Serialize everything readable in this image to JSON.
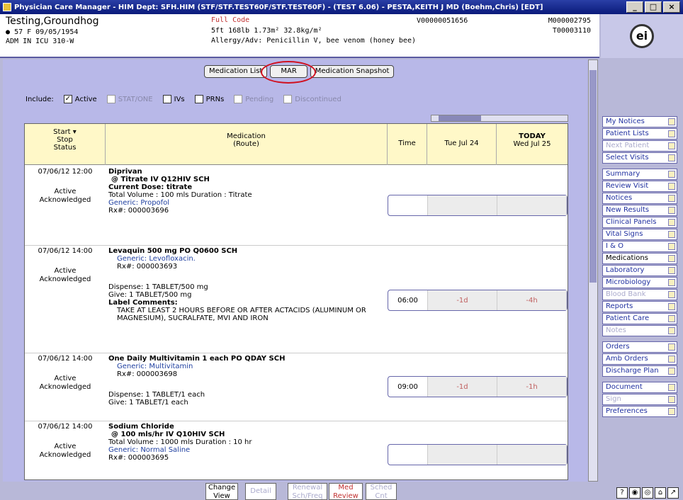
{
  "window": {
    "title": "Physician Care Manager - HIM Dept: SFH.HIM (STF/STF.TEST60F/STF.TEST60F) - (TEST 6.06) - PESTA,KEITH J MD (Boehm,Chris) [EDT]"
  },
  "patient": {
    "name": "Testing,Groundhog",
    "demo": "57 F 09/05/1954",
    "adm": "ADM IN ICU 310-W",
    "code": "Full Code",
    "vitals": "5ft 168lb 1.73m² 32.8kg/m²",
    "allergy": "Allergy/Adv: Penicillin V, bee venom (honey bee)",
    "visit": "V00000051656",
    "mrn": "M000002795",
    "unit": "T00003110"
  },
  "tabs": [
    "Medication List",
    "MAR",
    "Medication Snapshot"
  ],
  "include": {
    "label": "Include:",
    "options": [
      {
        "label": "Active",
        "checked": true,
        "disabled": false
      },
      {
        "label": "STAT/ONE",
        "checked": false,
        "disabled": true
      },
      {
        "label": "IVs",
        "checked": false,
        "disabled": false
      },
      {
        "label": "PRNs",
        "checked": false,
        "disabled": false
      },
      {
        "label": "Pending",
        "checked": false,
        "disabled": true
      },
      {
        "label": "Discontinued",
        "checked": false,
        "disabled": true
      }
    ]
  },
  "grid": {
    "col_start": "Start ▾",
    "col_stop": "Stop",
    "col_status": "Status",
    "col_med": "Medication",
    "col_route": "(Route)",
    "col_time": "Time",
    "col_d1": "Tue Jul 24",
    "col_today": "TODAY",
    "col_d2": "Wed Jul 25"
  },
  "meds": [
    {
      "start": "07/06/12 12:00",
      "status": "Active",
      "ack": "Acknowledged",
      "name": "Diprivan",
      "line2": "@ Titrate IV Q12HIV SCH",
      "line3": "Current Dose: titrate",
      "line4": "Total Volume : 100 mls     Duration : Titrate",
      "generic": "Generic: Propofol",
      "rx": "Rx#: 000003696",
      "time": "",
      "d1": "",
      "d2": ""
    },
    {
      "start": "07/06/12 14:00",
      "status": "Active",
      "ack": "Acknowledged",
      "name": "Levaquin  500 mg PO Q0600 SCH",
      "generic": "Generic: Levofloxacin.",
      "rx": "Rx#: 000003693",
      "dispense": "Dispense: 1 TABLET/500 mg",
      "give": "Give:  1 TABLET/500 mg",
      "comments_h": "Label Comments:",
      "comments": "TAKE AT LEAST 2 HOURS BEFORE OR AFTER  ACTACIDS (ALUMINUM OR MAGNESIUM), SUCRALFATE, MVI AND IRON",
      "time": "06:00",
      "d1": "-1d",
      "d2": "-4h"
    },
    {
      "start": "07/06/12 14:00",
      "status": "Active",
      "ack": "Acknowledged",
      "name": "One Daily Multivitamin  1 each PO QDAY SCH",
      "generic": "Generic: Multivitamin",
      "rx": "Rx#: 000003698",
      "dispense": "Dispense: 1 TABLET/1 each",
      "give": "Give:  1 TABLET/1 each",
      "time": "09:00",
      "d1": "-1d",
      "d2": "-1h"
    },
    {
      "start": "07/06/12 14:00",
      "status": "Active",
      "ack": "Acknowledged",
      "name": "Sodium Chloride",
      "line2": "@ 100 mls/hr IV Q10HIV SCH",
      "line4": "Total Volume : 1000 mls     Duration : 10 hr",
      "generic": "Generic: Normal Saline",
      "rx": "Rx#: 000003695",
      "time": "",
      "d1": "",
      "d2": ""
    }
  ],
  "sidebar": {
    "g1": [
      "My Notices",
      "Patient Lists",
      "Next Patient",
      "Select Visits"
    ],
    "g2": [
      "Summary",
      "Review Visit",
      "Notices",
      "New Results",
      "Clinical Panels",
      "Vital Signs",
      "I & O",
      "Medications",
      "Laboratory",
      "Microbiology",
      "Blood Bank",
      "Reports",
      "Patient Care",
      "Notes"
    ],
    "g3": [
      "Orders",
      "Amb Orders",
      "Discharge Plan"
    ],
    "g4": [
      "Document",
      "Sign",
      "Preferences"
    ]
  },
  "bottom": {
    "change": "Change View",
    "detail": "Detail",
    "renewal": "Renewal Sch/Freq",
    "medreview": "Med Review",
    "sched": "Sched Cnt"
  }
}
